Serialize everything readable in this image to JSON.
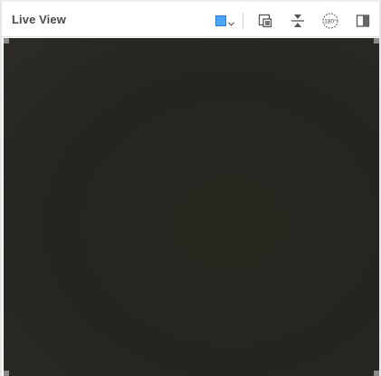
{
  "panel": {
    "title": "Live View"
  },
  "toolbar": {
    "color_swatch": "#4aa6ff",
    "icons": [
      "color-picker-icon",
      "picture-in-picture-icon",
      "flip-vertical-icon",
      "rotate-180-icon",
      "panel-toggle-icon"
    ],
    "rotate_label": "180°"
  },
  "viewport": {
    "background": "#26261f"
  }
}
